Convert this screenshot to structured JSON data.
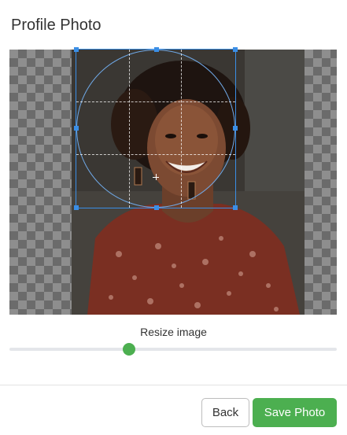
{
  "dialog": {
    "title": "Profile Photo"
  },
  "cropper": {
    "shape": "circle",
    "accent_color": "#3a8ee6"
  },
  "resize": {
    "label": "Resize image",
    "value_fraction": 0.37,
    "thumb_color": "#4caf50"
  },
  "footer": {
    "back_label": "Back",
    "save_label": "Save Photo",
    "save_color": "#4caf50"
  }
}
